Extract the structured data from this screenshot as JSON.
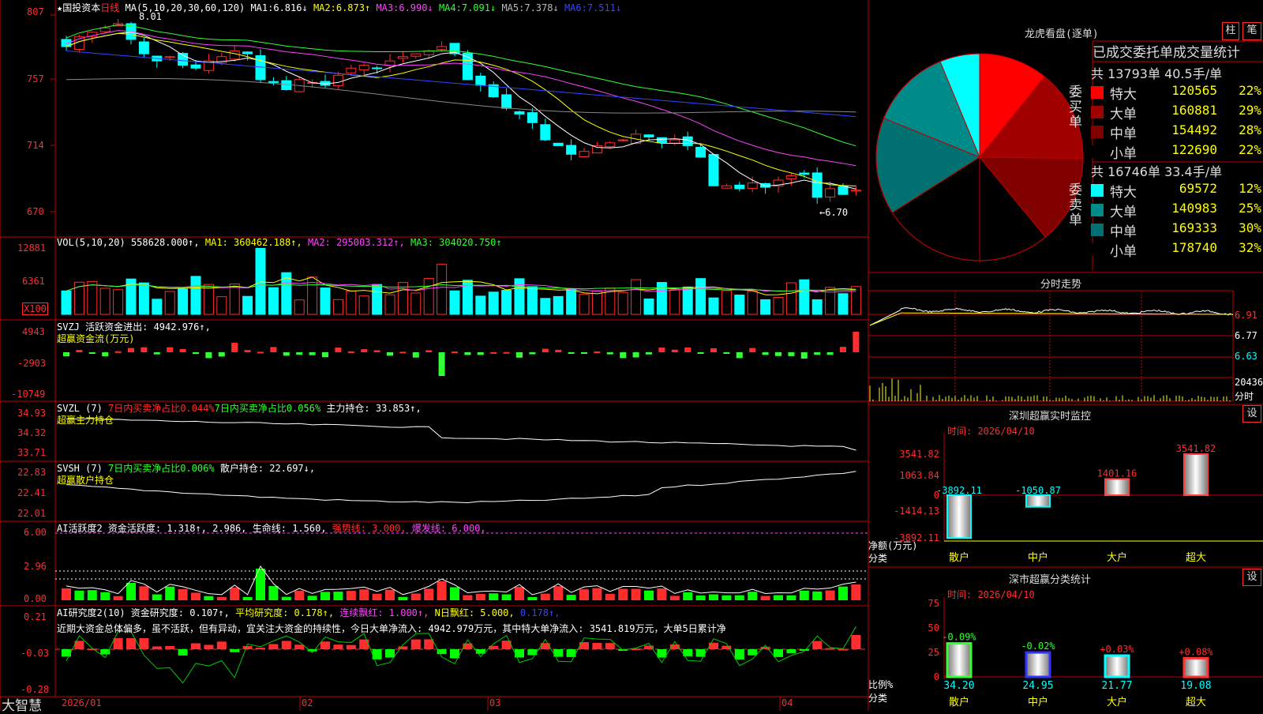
{
  "colors": {
    "up": "#ff2d2d",
    "down": "#00ffff",
    "bg": "#000000",
    "grid": "#c00000",
    "ma1": "#ffffff",
    "ma2": "#ffff00",
    "ma3": "#ff44ff",
    "ma4": "#33ff33",
    "ma5": "#888888",
    "ma6": "#3344ff"
  },
  "main": {
    "star": "★",
    "stock": "国投资本",
    "period": "日线",
    "ma_label": "MA(5,10,20,30,60,120)",
    "ma": [
      {
        "label": "MA1:",
        "value": "6.816↓"
      },
      {
        "label": "MA2:",
        "value": "6.873↑"
      },
      {
        "label": "MA3:",
        "value": "6.990↓"
      },
      {
        "label": "MA4:",
        "value": "7.091↓"
      },
      {
        "label": "MA5:",
        "value": "7.378↓"
      },
      {
        "label": "MA6:",
        "value": "7.511↓"
      }
    ],
    "y_ticks": [
      "807",
      "757",
      "714",
      "670"
    ],
    "high_label": "8.01",
    "low_label": "6.70"
  },
  "vol": {
    "title": "VOL(5,10,20)",
    "value": "558628.000↑",
    "ma1": "MA1: 360462.188↑",
    "ma2": "MA2: 295003.312↑",
    "ma3": "MA3: 304020.750↑",
    "y_ticks": [
      "12881",
      "6361"
    ],
    "unit": "X100"
  },
  "svzj": {
    "title": "SVZJ  活跃资金进出: 4942.976↑,",
    "sub": "超赢资金流(万元)",
    "y_ticks": [
      "4943",
      "-2903",
      "-10749"
    ]
  },
  "svzl": {
    "title": "SVZL (7)",
    "t1": "7日内买卖净占比0.044%",
    "t2": "7日内买卖净占比0.056%",
    "t3": "主力持仓: 33.853↑,",
    "sub": "超赢主力持仓",
    "y_ticks": [
      "34.93",
      "34.32",
      "33.71"
    ]
  },
  "svsh": {
    "title": "SVSH (7)",
    "t1": "7日内买卖净占比0.006%",
    "t2": "散户持仓: 22.697↓,",
    "sub": "超赢散户持仓",
    "y_ticks": [
      "22.83",
      "22.41",
      "22.01"
    ]
  },
  "ai1": {
    "title": "AI活跃度2 资金活跃度: 1.318↑,",
    "t1": "2.986,",
    "t2": "生命线: 1.560,",
    "t3": "强势线: 3.000,",
    "t4": "爆发线: 6.000,",
    "y_ticks": [
      "6.00",
      "2.96",
      "0.00"
    ]
  },
  "ai2": {
    "title": "AI研究度2(10)  资金研究度: 0.107↑,",
    "t1": "平均研究度: 0.178↑,",
    "t2": "连续飘红: 1.000↑,",
    "t3": "N日飘红: 5.000,",
    "t4": "0.178↑,",
    "comment": "近期大资金总体偏多，虽不活跃，但有异动，宜关注大资金的持续性，今日大单净流入: 4942.979万元，其中特大单净流入: 3541.819万元，大单5日累计净",
    "y_ticks": [
      "0.21",
      "-0.03",
      "-0.28"
    ]
  },
  "x_axis": {
    "labels": [
      "2026/01",
      "02",
      "03",
      "04"
    ]
  },
  "brand": "大智慧",
  "lhb": {
    "title": "龙虎看盘(逐单)",
    "btn1": "柱",
    "btn2": "笔",
    "table_title": "已成交委托单成交量统计",
    "buy": {
      "label": "委买单",
      "total": "共 13793单 40.5手/单",
      "rows": [
        {
          "name": "特大",
          "value": "120565",
          "pct": "22%",
          "color": "#ff0000"
        },
        {
          "name": "大单",
          "value": "160881",
          "pct": "29%",
          "color": "#a00000"
        },
        {
          "name": "中单",
          "value": "154492",
          "pct": "28%",
          "color": "#800000"
        },
        {
          "name": "小单",
          "value": "122690",
          "pct": "22%",
          "color": "#000000"
        }
      ]
    },
    "sell": {
      "label": "委卖单",
      "total": "共 16746单 33.4手/单",
      "rows": [
        {
          "name": "特大",
          "value": "69572",
          "pct": "12%",
          "color": "#00ffff"
        },
        {
          "name": "大单",
          "value": "140983",
          "pct": "25%",
          "color": "#008b8b"
        },
        {
          "name": "中单",
          "value": "169333",
          "pct": "30%",
          "color": "#007070"
        },
        {
          "name": "小单",
          "value": "178740",
          "pct": "32%",
          "color": "#000000"
        }
      ]
    }
  },
  "fenshi": {
    "title": "分时走势",
    "ticks": [
      "6.91",
      "6.77",
      "6.63"
    ],
    "vol_tick": "20436",
    "vol_unit": "分时"
  },
  "monitor": {
    "title": "深圳超赢实时监控",
    "btn": "设",
    "time": "时间: 2026/04/10",
    "ticks": [
      "3541.82",
      "1063.84",
      "0",
      "-1414.13",
      "-3892.11"
    ],
    "ylabel1": "净额(万元)",
    "ylabel2": "分类",
    "bars": [
      {
        "cat": "散户",
        "value": -3892.11,
        "label": "-3892.11"
      },
      {
        "cat": "中户",
        "value": -1050.87,
        "label": "-1050.87"
      },
      {
        "cat": "大户",
        "value": 1401.16,
        "label": "1401.16"
      },
      {
        "cat": "超大",
        "value": 3541.82,
        "label": "3541.82"
      }
    ]
  },
  "classify": {
    "title": "深市超赢分类统计",
    "btn": "设",
    "time": "时间: 2026/04/10",
    "ticks": [
      "75",
      "50",
      "25",
      "0"
    ],
    "ylabel1": "比例%",
    "ylabel2": "分类",
    "bars": [
      {
        "cat": "散户",
        "value": 34.2,
        "change": "-0.09%"
      },
      {
        "cat": "中户",
        "value": 24.95,
        "change": "-0.02%"
      },
      {
        "cat": "大户",
        "value": 21.77,
        "change": "+0.03%"
      },
      {
        "cat": "超大",
        "value": 19.08,
        "change": "+0.08%"
      }
    ]
  }
}
